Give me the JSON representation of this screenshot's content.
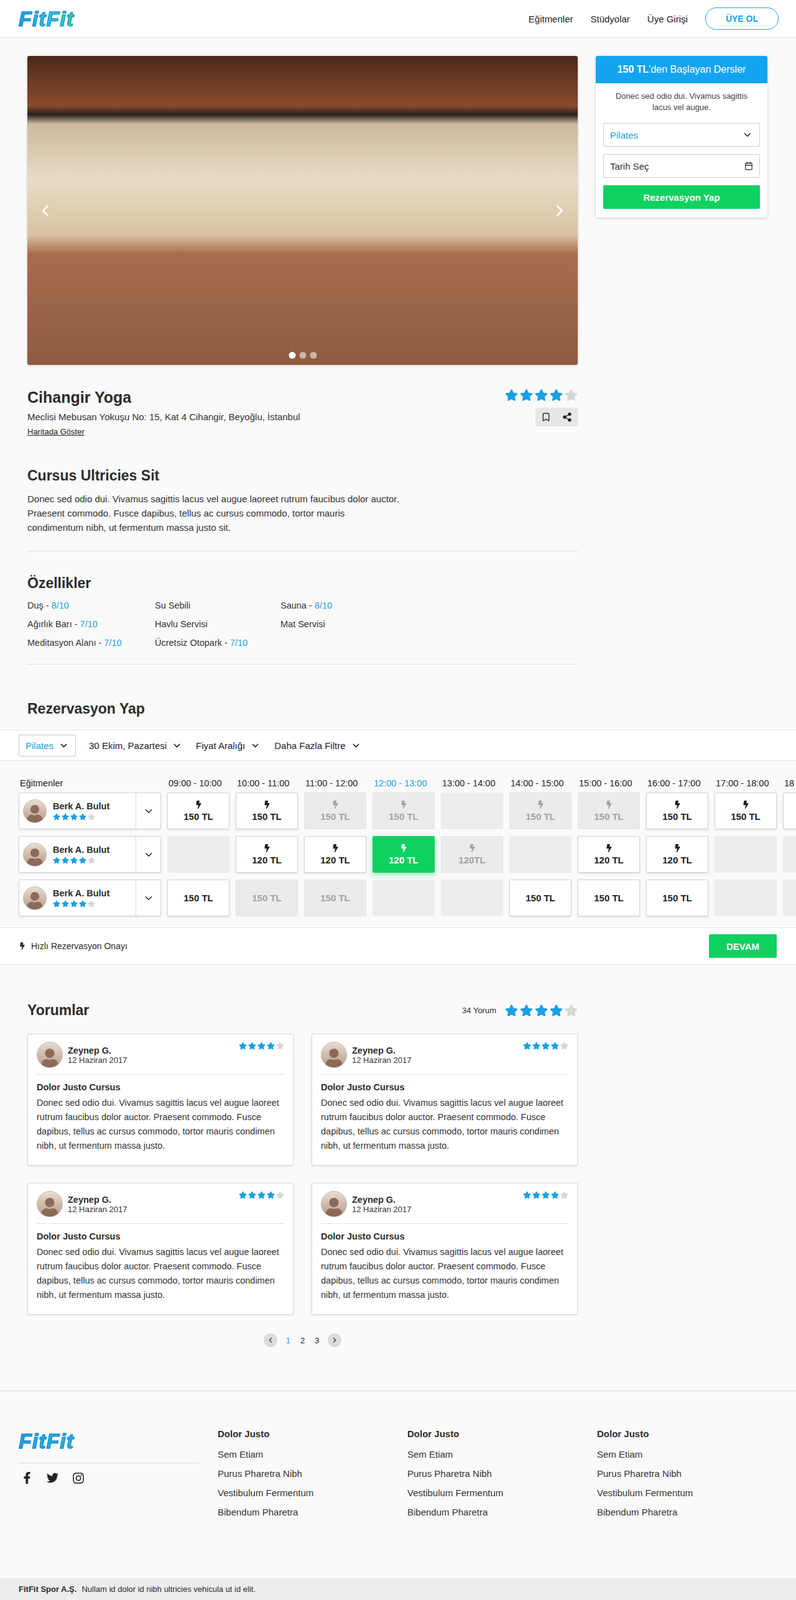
{
  "header": {
    "logo": "FitFit",
    "nav": [
      "Eğitmenler",
      "Stüdyolar",
      "Üye Girişi"
    ],
    "signup": "ÜYE OL"
  },
  "gallery": {
    "slides": [
      {
        "selected": true
      },
      {
        "selected": false
      },
      {
        "selected": false
      }
    ]
  },
  "booking_card": {
    "price": "150 TL",
    "title_suffix": "'den Başlayan Dersler",
    "description": "Donec sed odio dui. Vivamus sagittis lacus vel augue.",
    "class_select": "Pilates",
    "date_placeholder": "Tarih Seç",
    "button": "Rezervasyon Yap"
  },
  "studio": {
    "name": "Cihangir Yoga",
    "address": "Meclisi Mebusan Yokuşu No: 15, Kat 4 Cihangir, Beyoğlu, İstanbul",
    "map_link": "Haritada Göster",
    "stars": 4
  },
  "about": {
    "title": "Cursus Ultricies Sit",
    "text": "Donec sed odio dui. Vivamus sagittis lacus vel augue laoreet rutrum faucibus dolor auctor. Praesent commodo. Fusce dapibus, tellus ac cursus commodo, tortor mauris condimentum nibh, ut fermentum massa justo sit."
  },
  "features": {
    "title": "Özellikler",
    "dash": " - ",
    "items": [
      {
        "name": "Duş",
        "score": "8/10"
      },
      {
        "name": "Su Sebili",
        "score": ""
      },
      {
        "name": "Sauna",
        "score": "8/10"
      },
      {
        "name": "Ağırlık Barı",
        "score": "7/10"
      },
      {
        "name": "Havlu Servisi",
        "score": ""
      },
      {
        "name": "Mat Servisi",
        "score": ""
      },
      {
        "name": "Meditasyon Alanı",
        "score": "7/10"
      },
      {
        "name": "Ücretsiz Otopark",
        "score": "7/10"
      }
    ]
  },
  "reservation": {
    "title": "Rezervasyon Yap",
    "filters": [
      {
        "label": "Pilates",
        "selected": true
      },
      {
        "label": "30 Ekim, Pazartesi",
        "selected": false
      },
      {
        "label": "Fiyat Aralığı",
        "selected": false
      },
      {
        "label": "Daha Fazla Filtre",
        "selected": false
      }
    ],
    "trainers_label": "Eğitmenler",
    "times": [
      {
        "label": "09:00 - 10:00",
        "selected": false
      },
      {
        "label": "10:00 - 11:00",
        "selected": false
      },
      {
        "label": "11:00 - 12:00",
        "selected": false
      },
      {
        "label": "12:00 - 13:00",
        "selected": true
      },
      {
        "label": "13:00 - 14:00",
        "selected": false
      },
      {
        "label": "14:00 - 15:00",
        "selected": false
      },
      {
        "label": "15:00 - 16:00",
        "selected": false
      },
      {
        "label": "16:00 - 17:00",
        "selected": false
      },
      {
        "label": "17:00 - 18:00",
        "selected": false
      },
      {
        "label": "18",
        "selected": false
      }
    ],
    "trainers": [
      {
        "name": "Berk A. Bulut",
        "stars": 4,
        "expanded": false,
        "slots": [
          {
            "kind": "available",
            "bolt": true,
            "price": "150 TL",
            "selected": false
          },
          {
            "kind": "available",
            "bolt": true,
            "price": "150 TL",
            "selected": false
          },
          {
            "kind": "disabled",
            "bolt": true,
            "price": "150 TL",
            "selected": false
          },
          {
            "kind": "disabled",
            "bolt": true,
            "price": "150 TL",
            "selected": false
          },
          {
            "kind": "empty",
            "bolt": false,
            "price": "",
            "selected": false
          },
          {
            "kind": "disabled",
            "bolt": true,
            "price": "150 TL",
            "selected": false
          },
          {
            "kind": "disabled",
            "bolt": true,
            "price": "150 TL",
            "selected": false
          },
          {
            "kind": "available",
            "bolt": true,
            "price": "150 TL",
            "selected": false
          },
          {
            "kind": "available",
            "bolt": true,
            "price": "150 TL",
            "selected": false
          },
          {
            "kind": "available",
            "bolt": false,
            "price": "",
            "selected": false
          }
        ]
      },
      {
        "name": "Berk A. Bulut",
        "stars": 4,
        "expanded": false,
        "slots": [
          {
            "kind": "empty",
            "bolt": false,
            "price": "",
            "selected": false
          },
          {
            "kind": "available",
            "bolt": true,
            "price": "120 TL",
            "selected": false
          },
          {
            "kind": "available",
            "bolt": true,
            "price": "120 TL",
            "selected": false
          },
          {
            "kind": "available",
            "bolt": true,
            "price": "120 TL",
            "selected": true
          },
          {
            "kind": "disabled",
            "bolt": true,
            "price": "120TL",
            "selected": false
          },
          {
            "kind": "empty",
            "bolt": false,
            "price": "",
            "selected": false
          },
          {
            "kind": "available",
            "bolt": true,
            "price": "120 TL",
            "selected": false
          },
          {
            "kind": "available",
            "bolt": true,
            "price": "120 TL",
            "selected": false
          },
          {
            "kind": "empty",
            "bolt": false,
            "price": "",
            "selected": false
          },
          {
            "kind": "empty",
            "bolt": false,
            "price": "",
            "selected": false
          }
        ]
      },
      {
        "name": "Berk A. Bulut",
        "stars": 4,
        "expanded": false,
        "slots": [
          {
            "kind": "available",
            "bolt": false,
            "price": "150 TL",
            "selected": false
          },
          {
            "kind": "disabled",
            "bolt": false,
            "price": "150 TL",
            "selected": false
          },
          {
            "kind": "disabled",
            "bolt": false,
            "price": "150 TL",
            "selected": false
          },
          {
            "kind": "empty",
            "bolt": false,
            "price": "",
            "selected": false
          },
          {
            "kind": "empty",
            "bolt": false,
            "price": "",
            "selected": false
          },
          {
            "kind": "available",
            "bolt": false,
            "price": "150 TL",
            "selected": false
          },
          {
            "kind": "available",
            "bolt": false,
            "price": "150 TL",
            "selected": false
          },
          {
            "kind": "available",
            "bolt": false,
            "price": "150 TL",
            "selected": false
          },
          {
            "kind": "empty",
            "bolt": false,
            "price": "",
            "selected": false
          },
          {
            "kind": "empty",
            "bolt": false,
            "price": "",
            "selected": false
          }
        ]
      }
    ],
    "quick_label": "Hızlı Rezervasyon Onayı",
    "continue": "DEVAM"
  },
  "reviews": {
    "title": "Yorumlar",
    "count": "34 Yorum",
    "stars": 4,
    "items": [
      {
        "name": "Zeynep G.",
        "date": "12 Haziran 2017",
        "stars": 4,
        "title": "Dolor Justo Cursus",
        "text": "Donec sed odio dui. Vivamus sagittis lacus vel augue laoreet rutrum faucibus dolor auctor. Praesent commodo. Fusce dapibus, tellus ac cursus commodo, tortor mauris condimen nibh, ut fermentum massa justo."
      },
      {
        "name": "Zeynep G.",
        "date": "12 Haziran 2017",
        "stars": 4,
        "title": "Dolor Justo Cursus",
        "text": "Donec sed odio dui. Vivamus sagittis lacus vel augue laoreet rutrum faucibus dolor auctor. Praesent commodo. Fusce dapibus, tellus ac cursus commodo, tortor mauris condimen nibh, ut fermentum massa justo."
      },
      {
        "name": "Zeynep G.",
        "date": "12 Haziran 2017",
        "stars": 4,
        "title": "Dolor Justo Cursus",
        "text": "Donec sed odio dui. Vivamus sagittis lacus vel augue laoreet rutrum faucibus dolor auctor. Praesent commodo. Fusce dapibus, tellus ac cursus commodo, tortor mauris condimen nibh, ut fermentum massa justo."
      },
      {
        "name": "Zeynep G.",
        "date": "12 Haziran 2017",
        "stars": 4,
        "title": "Dolor Justo Cursus",
        "text": "Donec sed odio dui. Vivamus sagittis lacus vel augue laoreet rutrum faucibus dolor auctor. Praesent commodo. Fusce dapibus, tellus ac cursus commodo, tortor mauris condimen nibh, ut fermentum massa justo."
      }
    ],
    "pages": [
      {
        "label": "1",
        "selected": true
      },
      {
        "label": "2",
        "selected": false
      },
      {
        "label": "3",
        "selected": false
      }
    ]
  },
  "footer": {
    "logo": "FitFit",
    "columns": [
      {
        "title": "Dolor Justo",
        "links": [
          "Sem Etiam",
          "Purus Pharetra Nibh",
          "Vestibulum Fermentum",
          "Bibendum Pharetra"
        ]
      },
      {
        "title": "Dolor Justo",
        "links": [
          "Sem Etiam",
          "Purus Pharetra Nibh",
          "Vestibulum Fermentum",
          "Bibendum Pharetra"
        ]
      },
      {
        "title": "Dolor Justo",
        "links": [
          "Sem Etiam",
          "Purus Pharetra Nibh",
          "Vestibulum Fermentum",
          "Bibendum Pharetra"
        ]
      }
    ],
    "company": "FitFit Spor A.Ş.",
    "legal": "Nullam id dolor id nibh ultricies vehicula ut id elit."
  }
}
